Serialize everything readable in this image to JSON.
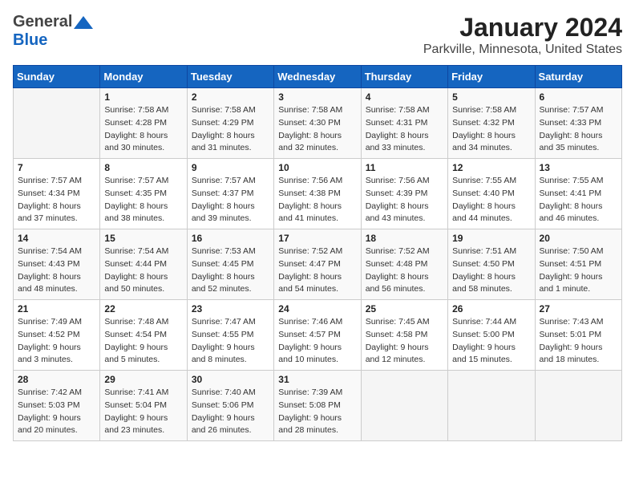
{
  "header": {
    "logo_line1": "General",
    "logo_line2": "Blue",
    "title": "January 2024",
    "subtitle": "Parkville, Minnesota, United States"
  },
  "days_of_week": [
    "Sunday",
    "Monday",
    "Tuesday",
    "Wednesday",
    "Thursday",
    "Friday",
    "Saturday"
  ],
  "weeks": [
    [
      {
        "day": "",
        "info": ""
      },
      {
        "day": "1",
        "info": "Sunrise: 7:58 AM\nSunset: 4:28 PM\nDaylight: 8 hours\nand 30 minutes."
      },
      {
        "day": "2",
        "info": "Sunrise: 7:58 AM\nSunset: 4:29 PM\nDaylight: 8 hours\nand 31 minutes."
      },
      {
        "day": "3",
        "info": "Sunrise: 7:58 AM\nSunset: 4:30 PM\nDaylight: 8 hours\nand 32 minutes."
      },
      {
        "day": "4",
        "info": "Sunrise: 7:58 AM\nSunset: 4:31 PM\nDaylight: 8 hours\nand 33 minutes."
      },
      {
        "day": "5",
        "info": "Sunrise: 7:58 AM\nSunset: 4:32 PM\nDaylight: 8 hours\nand 34 minutes."
      },
      {
        "day": "6",
        "info": "Sunrise: 7:57 AM\nSunset: 4:33 PM\nDaylight: 8 hours\nand 35 minutes."
      }
    ],
    [
      {
        "day": "7",
        "info": "Sunrise: 7:57 AM\nSunset: 4:34 PM\nDaylight: 8 hours\nand 37 minutes."
      },
      {
        "day": "8",
        "info": "Sunrise: 7:57 AM\nSunset: 4:35 PM\nDaylight: 8 hours\nand 38 minutes."
      },
      {
        "day": "9",
        "info": "Sunrise: 7:57 AM\nSunset: 4:37 PM\nDaylight: 8 hours\nand 39 minutes."
      },
      {
        "day": "10",
        "info": "Sunrise: 7:56 AM\nSunset: 4:38 PM\nDaylight: 8 hours\nand 41 minutes."
      },
      {
        "day": "11",
        "info": "Sunrise: 7:56 AM\nSunset: 4:39 PM\nDaylight: 8 hours\nand 43 minutes."
      },
      {
        "day": "12",
        "info": "Sunrise: 7:55 AM\nSunset: 4:40 PM\nDaylight: 8 hours\nand 44 minutes."
      },
      {
        "day": "13",
        "info": "Sunrise: 7:55 AM\nSunset: 4:41 PM\nDaylight: 8 hours\nand 46 minutes."
      }
    ],
    [
      {
        "day": "14",
        "info": "Sunrise: 7:54 AM\nSunset: 4:43 PM\nDaylight: 8 hours\nand 48 minutes."
      },
      {
        "day": "15",
        "info": "Sunrise: 7:54 AM\nSunset: 4:44 PM\nDaylight: 8 hours\nand 50 minutes."
      },
      {
        "day": "16",
        "info": "Sunrise: 7:53 AM\nSunset: 4:45 PM\nDaylight: 8 hours\nand 52 minutes."
      },
      {
        "day": "17",
        "info": "Sunrise: 7:52 AM\nSunset: 4:47 PM\nDaylight: 8 hours\nand 54 minutes."
      },
      {
        "day": "18",
        "info": "Sunrise: 7:52 AM\nSunset: 4:48 PM\nDaylight: 8 hours\nand 56 minutes."
      },
      {
        "day": "19",
        "info": "Sunrise: 7:51 AM\nSunset: 4:50 PM\nDaylight: 8 hours\nand 58 minutes."
      },
      {
        "day": "20",
        "info": "Sunrise: 7:50 AM\nSunset: 4:51 PM\nDaylight: 9 hours\nand 1 minute."
      }
    ],
    [
      {
        "day": "21",
        "info": "Sunrise: 7:49 AM\nSunset: 4:52 PM\nDaylight: 9 hours\nand 3 minutes."
      },
      {
        "day": "22",
        "info": "Sunrise: 7:48 AM\nSunset: 4:54 PM\nDaylight: 9 hours\nand 5 minutes."
      },
      {
        "day": "23",
        "info": "Sunrise: 7:47 AM\nSunset: 4:55 PM\nDaylight: 9 hours\nand 8 minutes."
      },
      {
        "day": "24",
        "info": "Sunrise: 7:46 AM\nSunset: 4:57 PM\nDaylight: 9 hours\nand 10 minutes."
      },
      {
        "day": "25",
        "info": "Sunrise: 7:45 AM\nSunset: 4:58 PM\nDaylight: 9 hours\nand 12 minutes."
      },
      {
        "day": "26",
        "info": "Sunrise: 7:44 AM\nSunset: 5:00 PM\nDaylight: 9 hours\nand 15 minutes."
      },
      {
        "day": "27",
        "info": "Sunrise: 7:43 AM\nSunset: 5:01 PM\nDaylight: 9 hours\nand 18 minutes."
      }
    ],
    [
      {
        "day": "28",
        "info": "Sunrise: 7:42 AM\nSunset: 5:03 PM\nDaylight: 9 hours\nand 20 minutes."
      },
      {
        "day": "29",
        "info": "Sunrise: 7:41 AM\nSunset: 5:04 PM\nDaylight: 9 hours\nand 23 minutes."
      },
      {
        "day": "30",
        "info": "Sunrise: 7:40 AM\nSunset: 5:06 PM\nDaylight: 9 hours\nand 26 minutes."
      },
      {
        "day": "31",
        "info": "Sunrise: 7:39 AM\nSunset: 5:08 PM\nDaylight: 9 hours\nand 28 minutes."
      },
      {
        "day": "",
        "info": ""
      },
      {
        "day": "",
        "info": ""
      },
      {
        "day": "",
        "info": ""
      }
    ]
  ]
}
